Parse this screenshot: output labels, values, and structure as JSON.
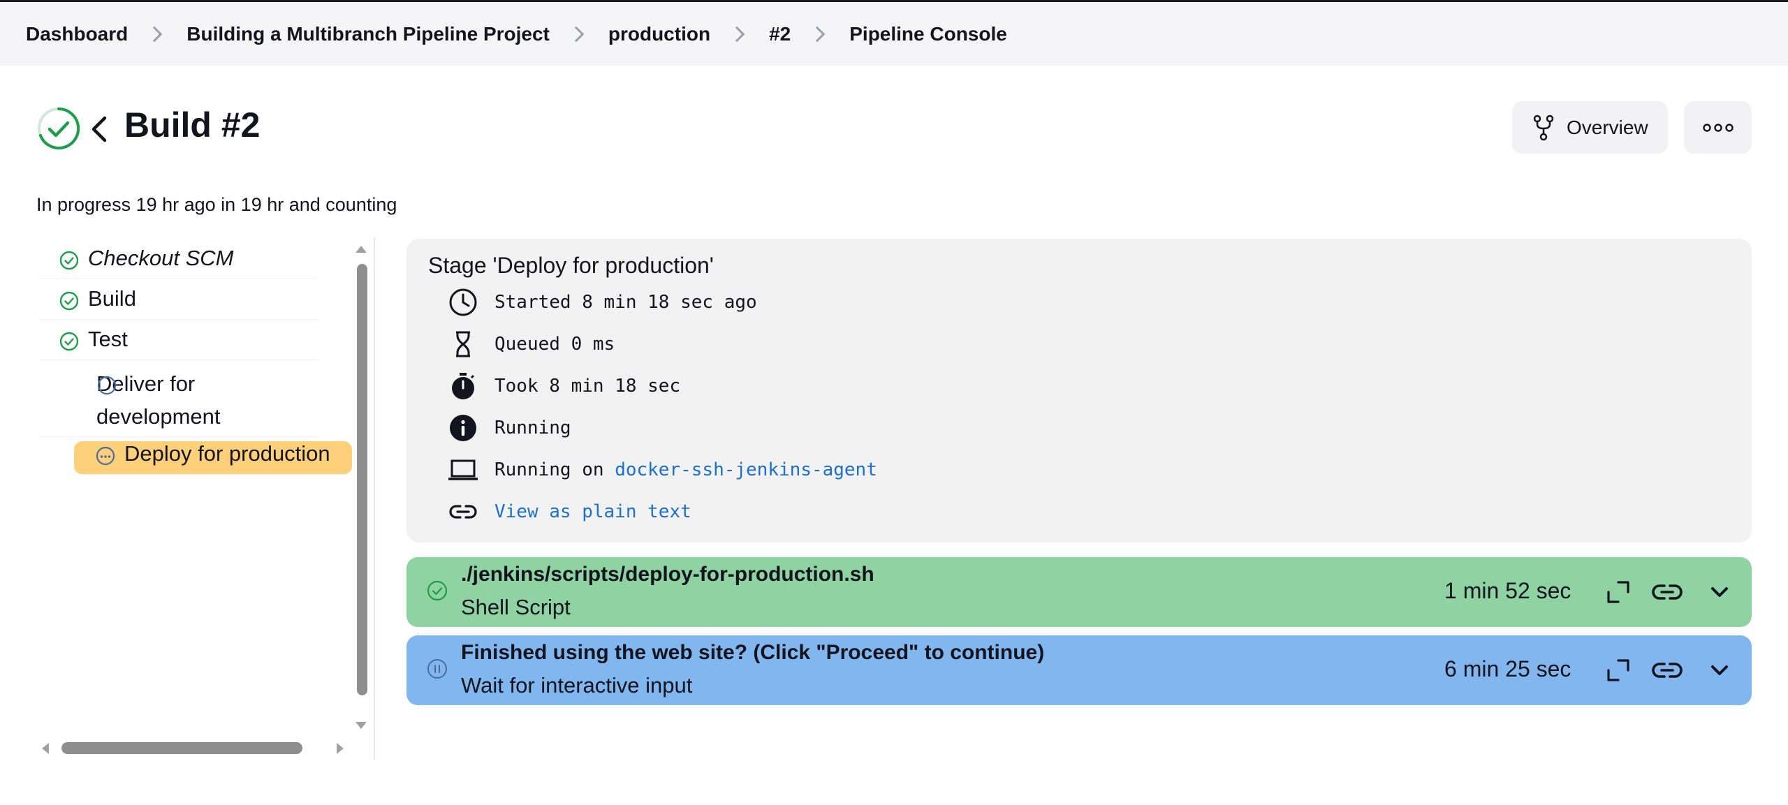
{
  "breadcrumb": {
    "items": [
      "Dashboard",
      "Building a Multibranch Pipeline Project",
      "production",
      "#2",
      "Pipeline Console"
    ]
  },
  "header": {
    "title": "Build #2",
    "overview_label": "Overview",
    "status": "in-progress",
    "subtitle": "In progress 19 hr ago in 19 hr and counting"
  },
  "stages": [
    {
      "label": "Checkout SCM",
      "status": "success",
      "italic": true
    },
    {
      "label": "Build",
      "status": "success"
    },
    {
      "label": "Test",
      "status": "success"
    },
    {
      "label": "Deliver for development",
      "status": "not-built"
    },
    {
      "label": "Deploy for production",
      "status": "running",
      "selected": true
    }
  ],
  "details": {
    "title": "Stage 'Deploy for production'",
    "started": "Started 8 min 18 sec ago",
    "queued": "Queued 0 ms",
    "took": "Took 8 min 18 sec",
    "state": "Running",
    "running_on_prefix": "Running on ",
    "agent": "docker-ssh-jenkins-agent",
    "plain_text_link": "View as plain text"
  },
  "steps": [
    {
      "title": "./jenkins/scripts/deploy-for-production.sh",
      "subtitle": "Shell Script",
      "duration": "1 min 52 sec",
      "status": "success",
      "color": "#8fd3a2"
    },
    {
      "title": "Finished using the web site? (Click \"Proceed\" to continue)",
      "subtitle": "Wait for interactive input",
      "duration": "6 min 25 sec",
      "status": "paused",
      "color": "#82b6ef"
    }
  ],
  "colors": {
    "success": "#1e9e4b",
    "running_highlight": "#ffd07a",
    "link": "#1a6fd0"
  },
  "icons": [
    "check-circle-icon",
    "back-icon",
    "fork-icon",
    "ellipsis-icon",
    "clock-icon",
    "hourglass-icon",
    "stopwatch-icon",
    "info-icon",
    "laptop-icon",
    "link-icon",
    "expand-icon",
    "chevron-down-icon",
    "pause-circle-icon",
    "running-circle-icon",
    "empty-circle-icon"
  ]
}
